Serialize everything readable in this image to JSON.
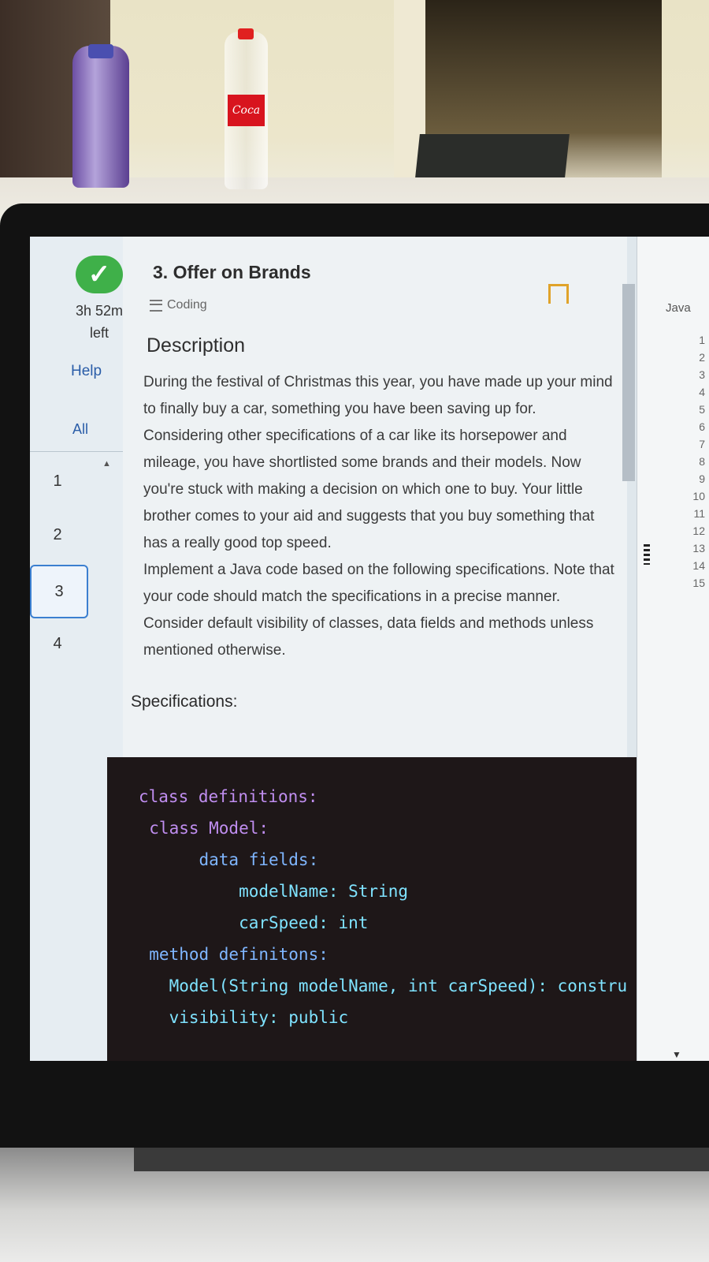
{
  "scene": {
    "bottle_label": "Coca"
  },
  "sidebar": {
    "status_icon": "check-icon",
    "time_left": "3h 52m",
    "time_left_suffix": "left",
    "help_label": "Help",
    "all_label": "All",
    "questions": [
      "1",
      "2",
      "3",
      "4"
    ],
    "active_question": "3"
  },
  "problem": {
    "title": "3. Offer on Brands",
    "type": "Coding",
    "description_heading": "Description",
    "description_paragraphs": [
      "During the festival of Christmas this year, you have made up your mind to finally buy a car, something you have been saving up for. Considering other specifications of a car like its horsepower and mileage, you have shortlisted some brands and their models. Now you're stuck with making a decision on which one to buy. Your little brother comes to your aid and suggests that you buy something that has a really good top speed.",
      "Implement a Java code based on the following specifications. Note that your code should match the specifications in a precise manner. Consider default visibility of classes, data fields and methods unless mentioned otherwise."
    ],
    "specifications_heading": "Specifications:",
    "code_lines": [
      "class definitions:",
      "  class Model:",
      "       data fields:",
      "           modelName: String",
      "           carSpeed: int",
      "",
      "  method definitons:",
      "    Model(String modelName, int carSpeed): constru",
      "    visibility: public"
    ]
  },
  "editor": {
    "language": "Java",
    "line_numbers": [
      "1",
      "2",
      "3",
      "4",
      "5",
      "6",
      "7",
      "8",
      "9",
      "10",
      "11",
      "12",
      "13",
      "14",
      "15"
    ]
  },
  "colors": {
    "accent": "#2a5da8",
    "success": "#3fb049",
    "bookmark": "#e0a32a",
    "code_bg": "#1e1718"
  }
}
